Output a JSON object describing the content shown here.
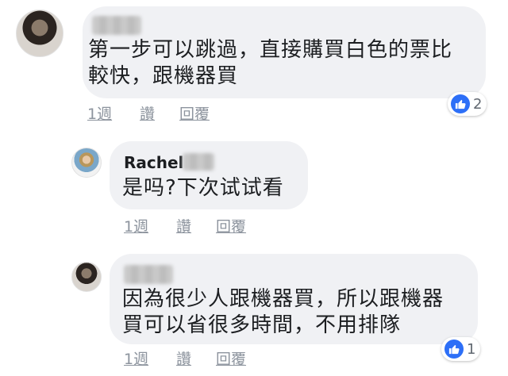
{
  "comments": [
    {
      "author": "",
      "text": "第一步可以跳過，直接購買白色的票比\n較快，跟機器買",
      "actions": {
        "time": "1週",
        "like": "讚",
        "reply": "回覆"
      },
      "reactions": {
        "icon": "like-icon",
        "count": "2"
      }
    },
    {
      "author": "Rachel",
      "text": "是吗?下次试试看",
      "actions": {
        "time": "1週",
        "like": "讚",
        "reply": "回覆"
      }
    },
    {
      "author": "",
      "text": "因為很少人跟機器買，所以跟機器\n買可以省很多時間，不用排隊",
      "actions": {
        "time": "1週",
        "like": "讚",
        "reply": "回覆"
      },
      "reactions": {
        "icon": "like-icon",
        "count": "1"
      }
    }
  ],
  "colors": {
    "bubble": "#f0f1f4",
    "like_blue": "#2d6ff7",
    "action_gray": "#8d949e"
  }
}
